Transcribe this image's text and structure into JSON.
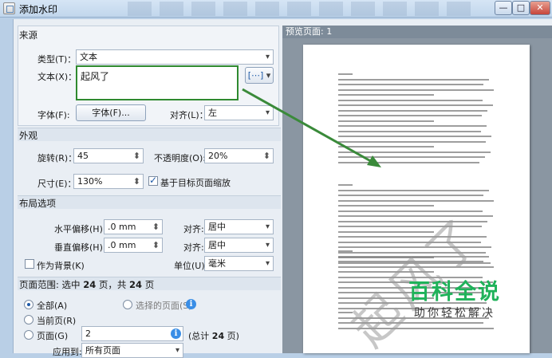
{
  "window": {
    "title": "添加水印",
    "min": "—",
    "max": "□",
    "close": "✕"
  },
  "source": {
    "title": "来源",
    "type_label": "类型(T)：",
    "type_value": "文本",
    "text_label": "文本(X)：",
    "text_value": "起风了",
    "insert_btn": "[⋯]",
    "font_label": "字体(F):",
    "font_btn": "字体(F)...",
    "align_label": "对齐(L)：",
    "align_value": "左"
  },
  "appearance": {
    "title": "外观",
    "rotate_label": "旋转(R)：",
    "rotate_value": "45",
    "opacity_label": "不透明度(O):",
    "opacity_value": "20%",
    "size_label": "尺寸(E)：",
    "size_value": "130%",
    "scale_label": "基于目标页面缩放"
  },
  "layout": {
    "title": "布局选项",
    "hoffset_label": "水平偏移(H):",
    "hoffset_value": ".0 mm",
    "halign_label": "对齐:",
    "halign_value": "居中",
    "voffset_label": "垂直偏移(H):",
    "voffset_value": ".0 mm",
    "valign_label": "对齐:",
    "valign_value": "居中",
    "background_label": "作为背景(K)",
    "unit_label": "单位(U):",
    "unit_value": "毫米"
  },
  "range": {
    "title_a": "页面范围: 选中",
    "count_a": "24",
    "title_b": "页，共",
    "count_b": "24",
    "title_c": "页",
    "all_label": "全部(A)",
    "selected_label": "选择的页面(S)",
    "current_label": "当前页(R)",
    "pages_label": "页面(G)",
    "pages_value": "2",
    "total_a": "(总计",
    "total_count": "24",
    "total_b": "页)",
    "apply_label": "应用到:",
    "apply_value": "所有页面"
  },
  "preview": {
    "header": "预览页面: 1",
    "watermark": "起风了"
  },
  "site_logo": {
    "main": "百科全说",
    "sub": "助你轻松解决"
  },
  "colors": {
    "highlight": "#2f8a2f",
    "logo_green": "#1fb25a",
    "accent": "#1e5aa8"
  }
}
